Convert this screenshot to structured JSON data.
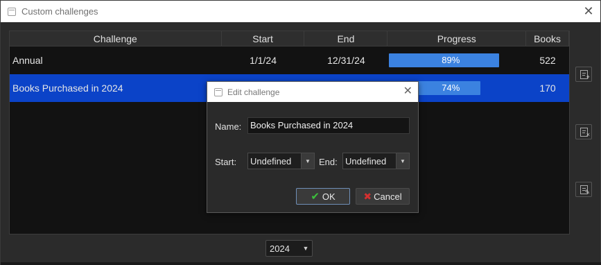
{
  "window": {
    "title": "Custom challenges",
    "close_glyph": "✕"
  },
  "table": {
    "headers": {
      "challenge": "Challenge",
      "start": "Start",
      "end": "End",
      "progress": "Progress",
      "books": "Books"
    },
    "rows": [
      {
        "challenge": "Annual",
        "start": "1/1/24",
        "end": "12/31/24",
        "progress_text": "89%",
        "progress_fraction": 0.89,
        "books": "522",
        "selected": false
      },
      {
        "challenge": "Books Purchased in 2024",
        "start": "",
        "end": "",
        "progress_text": "74%",
        "progress_fraction": 0.74,
        "books": "170",
        "selected": true
      }
    ]
  },
  "side_buttons": [
    {
      "icon": "add-item-icon"
    },
    {
      "icon": "remove-item-icon"
    },
    {
      "icon": "edit-item-icon"
    }
  ],
  "year_select": {
    "value": "2024",
    "caret": "▼"
  },
  "dialog": {
    "title": "Edit challenge",
    "close_glyph": "✕",
    "name_label": "Name:",
    "name_value": "Books Purchased in 2024",
    "start_label": "Start:",
    "start_value": "Undefined",
    "end_label": "End:",
    "end_value": "Undefined",
    "caret": "▼",
    "ok_label": "OK",
    "ok_glyph": "✔",
    "cancel_label": "Cancel",
    "cancel_glyph": "✖"
  },
  "colors": {
    "selection": "#0b43c8",
    "progress_fill": "#3b82e0",
    "background": "#2b2b2b"
  }
}
